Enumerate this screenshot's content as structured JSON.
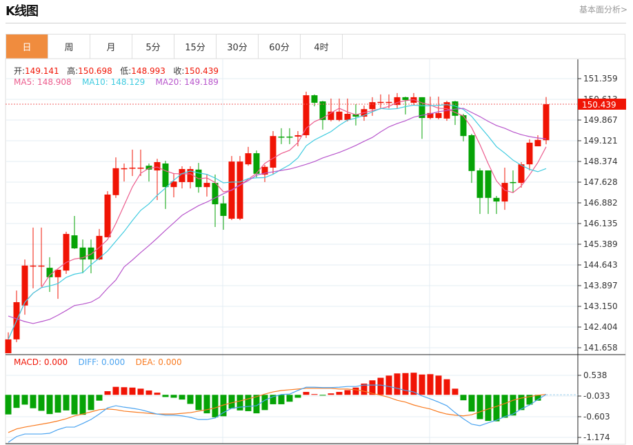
{
  "header": {
    "title": "K线图",
    "link": "基本面分析>"
  },
  "tabs": [
    {
      "label": "日",
      "active": true
    },
    {
      "label": "周"
    },
    {
      "label": "月"
    },
    {
      "label": "5分"
    },
    {
      "label": "15分"
    },
    {
      "label": "30分"
    },
    {
      "label": "60分"
    },
    {
      "label": "4时"
    }
  ],
  "legend": {
    "open_label": "开:",
    "open": "149.141",
    "high_label": "高:",
    "high": "150.698",
    "low_label": "低:",
    "low": "148.993",
    "close_label": "收:",
    "close": "150.439",
    "ma5": "MA5: 148.908",
    "ma10": "MA10: 148.129",
    "ma20": "MA20: 149.189",
    "macd": "MACD: 0.000",
    "diff": "DIFF: 0.000",
    "dea": "DEA: 0.000"
  },
  "colors": {
    "up": "#f01405",
    "down": "#06a306",
    "ma5": "#ec5c8d",
    "ma10": "#3fcbe0",
    "ma20": "#b856cc",
    "diff": "#4aa3f0",
    "dea": "#f97a1f",
    "accent": "#f08c3e",
    "last_price_bg": "#f01405"
  },
  "chart_data": {
    "type": "candlestick",
    "last_price": "150.439",
    "price_axis": {
      "ylim": [
        141.658,
        151.359
      ],
      "ticks": [
        "151.359",
        "150.613",
        "149.867",
        "149.121",
        "148.374",
        "147.628",
        "146.882",
        "146.135",
        "145.389",
        "144.643",
        "143.897",
        "143.150",
        "142.404",
        "141.658"
      ]
    },
    "macd_axis": {
      "ylim": [
        -1.174,
        0.538
      ],
      "ticks": [
        "0.538",
        "-0.033",
        "-0.603",
        "-1.174"
      ]
    },
    "grid": true,
    "ohlc": [
      [
        141.46,
        142.21,
        141.46,
        141.96
      ],
      [
        141.96,
        143.72,
        141.86,
        143.3
      ],
      [
        143.18,
        144.84,
        142.85,
        144.62
      ],
      [
        144.62,
        145.99,
        143.8,
        144.62
      ],
      [
        144.62,
        145.99,
        143.87,
        144.62
      ],
      [
        144.54,
        144.92,
        143.67,
        144.2
      ],
      [
        144.2,
        144.47,
        143.42,
        144.47
      ],
      [
        144.44,
        145.84,
        144.32,
        145.76
      ],
      [
        145.71,
        146.41,
        145.22,
        145.24
      ],
      [
        145.27,
        145.56,
        144.34,
        144.84
      ],
      [
        145.27,
        145.56,
        144.34,
        144.84
      ],
      [
        144.84,
        145.94,
        144.82,
        145.69
      ],
      [
        145.64,
        147.3,
        145.64,
        147.18
      ],
      [
        147.16,
        148.52,
        147.06,
        148.13
      ],
      [
        148.1,
        148.3,
        147.65,
        148.13
      ],
      [
        148.13,
        148.8,
        147.85,
        148.15
      ],
      [
        148.13,
        148.8,
        147.85,
        148.15
      ],
      [
        148.22,
        148.3,
        147.65,
        148.08
      ],
      [
        148.05,
        148.47,
        146.98,
        148.35
      ],
      [
        148.3,
        148.4,
        146.66,
        147.45
      ],
      [
        147.45,
        147.93,
        147.08,
        147.65
      ],
      [
        147.63,
        148.2,
        147.4,
        148.1
      ],
      [
        147.63,
        148.2,
        147.4,
        148.1
      ],
      [
        148.08,
        148.32,
        147.25,
        147.45
      ],
      [
        147.45,
        147.9,
        147.11,
        147.6
      ],
      [
        147.6,
        147.9,
        146.01,
        146.83
      ],
      [
        146.86,
        147.13,
        145.91,
        146.41
      ],
      [
        146.31,
        148.57,
        146.26,
        148.37
      ],
      [
        146.31,
        148.57,
        146.26,
        148.37
      ],
      [
        148.27,
        148.9,
        148.22,
        148.67
      ],
      [
        148.67,
        148.77,
        147.8,
        147.93
      ],
      [
        147.9,
        148.25,
        147.63,
        148.18
      ],
      [
        148.15,
        149.47,
        147.93,
        149.29
      ],
      [
        149.27,
        149.57,
        149.0,
        149.24
      ],
      [
        149.27,
        149.57,
        149.0,
        149.24
      ],
      [
        149.27,
        149.47,
        148.92,
        149.32
      ],
      [
        149.32,
        150.89,
        149.22,
        150.76
      ],
      [
        150.76,
        150.79,
        150.36,
        150.49
      ],
      [
        150.54,
        150.56,
        149.52,
        149.87
      ],
      [
        149.87,
        150.64,
        149.82,
        150.17
      ],
      [
        149.87,
        150.64,
        149.82,
        150.17
      ],
      [
        149.87,
        150.64,
        149.82,
        150.09
      ],
      [
        150.07,
        150.44,
        149.67,
        149.99
      ],
      [
        149.99,
        150.39,
        149.84,
        150.26
      ],
      [
        150.26,
        150.69,
        150.02,
        150.51
      ],
      [
        150.51,
        150.79,
        150.29,
        150.52
      ],
      [
        150.51,
        150.79,
        150.29,
        150.52
      ],
      [
        150.41,
        150.84,
        150.29,
        150.69
      ],
      [
        150.69,
        150.71,
        150.07,
        150.59
      ],
      [
        150.49,
        150.84,
        150.39,
        150.69
      ],
      [
        150.69,
        150.69,
        149.19,
        149.94
      ],
      [
        149.94,
        150.71,
        149.89,
        150.12
      ],
      [
        149.94,
        150.71,
        149.89,
        150.12
      ],
      [
        149.92,
        150.56,
        149.84,
        150.51
      ],
      [
        150.54,
        150.56,
        149.69,
        150.02
      ],
      [
        150.04,
        150.09,
        149.1,
        149.29
      ],
      [
        149.32,
        149.37,
        147.6,
        148.03
      ],
      [
        148.05,
        148.13,
        146.48,
        147.06
      ],
      [
        148.05,
        148.05,
        146.48,
        147.06
      ],
      [
        147.06,
        147.13,
        146.48,
        146.93
      ],
      [
        146.93,
        148.15,
        146.63,
        147.6
      ],
      [
        147.63,
        148.05,
        147.25,
        147.6
      ],
      [
        147.6,
        148.35,
        147.43,
        148.27
      ],
      [
        148.27,
        149.17,
        148.05,
        149.05
      ],
      [
        148.92,
        149.32,
        148.92,
        149.15
      ],
      [
        149.141,
        150.698,
        148.993,
        150.439
      ]
    ],
    "ma20": [
      142.8,
      142.7,
      142.6,
      142.53,
      142.6,
      142.68,
      142.83,
      143.0,
      143.18,
      143.23,
      143.3,
      143.47,
      143.8,
      144.1,
      144.57,
      144.82,
      145.09,
      145.34,
      145.61,
      145.89,
      146.16,
      146.43,
      146.61,
      146.78,
      146.91,
      147.06,
      147.21,
      147.35,
      147.53,
      147.68,
      147.88,
      147.95,
      148.0,
      148.05,
      148.1,
      148.18,
      148.27,
      148.37,
      148.5,
      148.6,
      148.7,
      148.82,
      148.95,
      149.1,
      149.24,
      149.44,
      149.62,
      149.74,
      149.84,
      149.97,
      150.04,
      150.09,
      150.17,
      150.21,
      150.26,
      150.29,
      150.14,
      149.99,
      149.82,
      149.67,
      149.57,
      149.44,
      149.34,
      149.27,
      149.22,
      149.189
    ],
    "macd": [
      -0.54,
      -0.36,
      -0.27,
      -0.37,
      -0.44,
      -0.53,
      -0.49,
      -0.43,
      -0.54,
      -0.55,
      -0.42,
      -0.16,
      0.1,
      0.22,
      0.21,
      0.2,
      0.17,
      0.12,
      0.06,
      -0.06,
      -0.08,
      -0.13,
      -0.25,
      -0.42,
      -0.51,
      -0.62,
      -0.59,
      -0.38,
      -0.43,
      -0.45,
      -0.51,
      -0.42,
      -0.26,
      -0.26,
      -0.19,
      -0.08,
      0.08,
      0.02,
      -0.02,
      0.04,
      0.08,
      0.13,
      0.2,
      0.31,
      0.4,
      0.47,
      0.53,
      0.59,
      0.6,
      0.61,
      0.56,
      0.57,
      0.53,
      0.43,
      0.17,
      -0.15,
      -0.46,
      -0.67,
      -0.72,
      -0.73,
      -0.63,
      -0.57,
      -0.42,
      -0.27,
      -0.16,
      0.0
    ],
    "diff": [
      -1.31,
      -1.15,
      -1.08,
      -1.08,
      -1.08,
      -1.06,
      -0.96,
      -0.89,
      -0.89,
      -0.79,
      -0.68,
      -0.53,
      -0.36,
      -0.3,
      -0.34,
      -0.37,
      -0.41,
      -0.47,
      -0.53,
      -0.56,
      -0.56,
      -0.58,
      -0.62,
      -0.68,
      -0.68,
      -0.64,
      -0.49,
      -0.37,
      -0.34,
      -0.32,
      -0.3,
      -0.15,
      -0.05,
      0.01,
      0.02,
      0.12,
      0.21,
      0.21,
      0.2,
      0.2,
      0.21,
      0.23,
      0.23,
      0.27,
      0.27,
      0.27,
      0.23,
      0.18,
      0.12,
      0.08,
      -0.03,
      -0.11,
      -0.2,
      -0.3,
      -0.49,
      -0.66,
      -0.81,
      -0.85,
      -0.77,
      -0.7,
      -0.6,
      -0.53,
      -0.39,
      -0.28,
      -0.13,
      0.01
    ],
    "dea": [
      -1.04,
      -0.94,
      -0.89,
      -0.85,
      -0.81,
      -0.77,
      -0.72,
      -0.66,
      -0.58,
      -0.53,
      -0.47,
      -0.41,
      -0.39,
      -0.41,
      -0.45,
      -0.47,
      -0.49,
      -0.51,
      -0.53,
      -0.53,
      -0.53,
      -0.51,
      -0.49,
      -0.45,
      -0.41,
      -0.36,
      -0.28,
      -0.22,
      -0.17,
      -0.11,
      -0.05,
      0.02,
      0.08,
      0.12,
      0.14,
      0.16,
      0.18,
      0.18,
      0.18,
      0.18,
      0.16,
      0.16,
      0.14,
      0.1,
      0.04,
      -0.01,
      -0.07,
      -0.15,
      -0.2,
      -0.28,
      -0.34,
      -0.39,
      -0.47,
      -0.53,
      -0.56,
      -0.58,
      -0.55,
      -0.47,
      -0.39,
      -0.32,
      -0.24,
      -0.15,
      -0.09,
      -0.05,
      -0.01,
      0.01
    ]
  }
}
